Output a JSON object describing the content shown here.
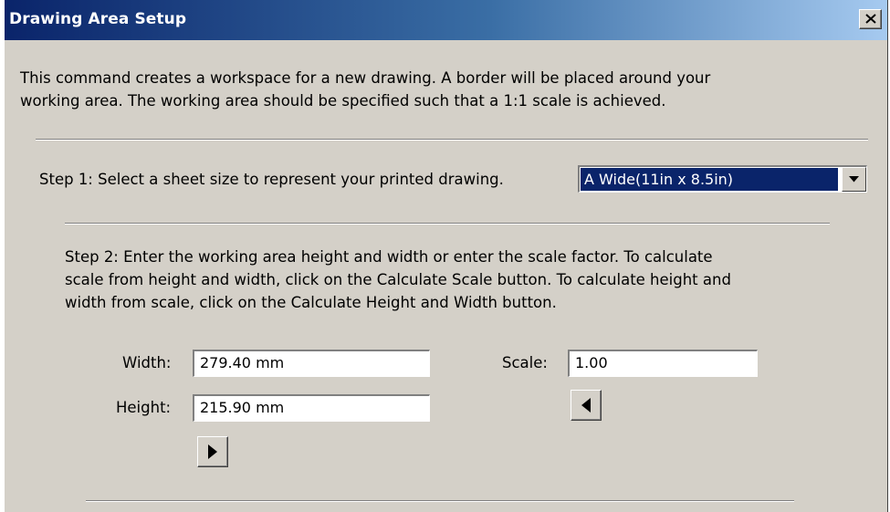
{
  "window": {
    "title": "Drawing Area Setup",
    "close_icon": "close-x-icon"
  },
  "intro": {
    "line1": "This command creates a workspace for a new drawing.  A border will be placed around your",
    "line2": "working area.  The working area should be specified such that a 1:1 scale is achieved."
  },
  "step1": {
    "label": "Step 1: Select a sheet size to represent your printed drawing.",
    "sheet_size_selected": "A Wide(11in x 8.5in)",
    "dropdown_icon": "chevron-down-icon"
  },
  "step2": {
    "line1": "Step 2: Enter the working area height and width or enter the scale factor.  To calculate",
    "line2": "scale from height and width, click on the Calculate Scale button.  To calculate height and",
    "line3": "width from scale, click on the Calculate Height and Width button."
  },
  "fields": {
    "width_label": "Width:",
    "width_value": "279.40 mm",
    "height_label": "Height:",
    "height_value": "215.90 mm",
    "scale_label": "Scale:",
    "scale_value": "1.00"
  },
  "buttons": {
    "calculate_height_width_icon": "triangle-left-icon",
    "calculate_scale_icon": "triangle-right-icon"
  },
  "colors": {
    "title_bar_start": "#0a246a",
    "title_bar_end": "#a6caf0",
    "dialog_face": "#d4d0c8",
    "selection_highlight": "#0a246a"
  }
}
